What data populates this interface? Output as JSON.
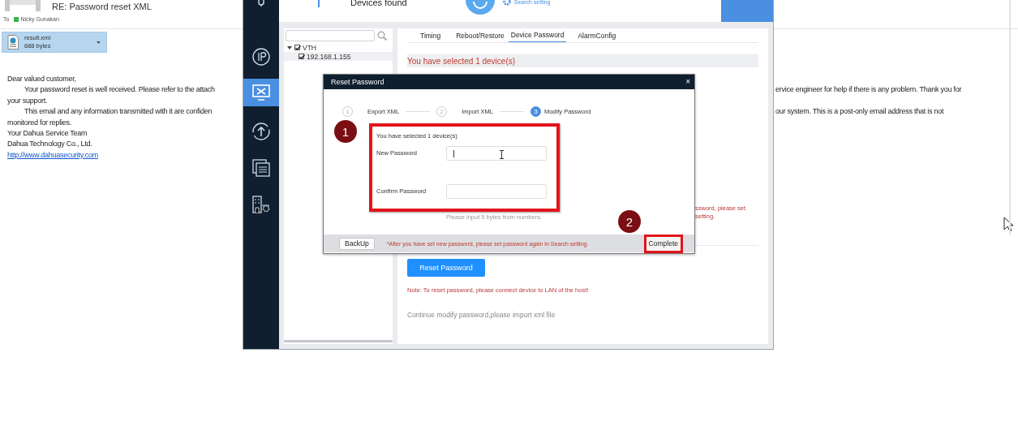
{
  "email": {
    "subject": "RE: Password reset XML",
    "to_label": "To",
    "recipient": "Nicky Gunakan",
    "attachment": {
      "name": "result.xml",
      "size": "688 bytes"
    },
    "lines": [
      {
        "text": "Dear valued customer,",
        "indent": false
      },
      {
        "text": "Your password reset is well received. Please refer to the attach",
        "indent": true,
        "right": "ervice engineer for help if there is any problem. Thank you for"
      },
      {
        "text": "your support.",
        "indent": false
      },
      {
        "text": "This email and any information transmitted with it are confiden",
        "indent": true,
        "right": "our system. This is a post-only email address that is not"
      },
      {
        "text": "monitored for replies.",
        "indent": false
      },
      {
        "text": "Your Dahua Service Team",
        "indent": false
      },
      {
        "text": "Dahua Technology Co., Ltd.",
        "indent": false
      }
    ],
    "link": "http://www.dahuasecurity.com"
  },
  "app": {
    "header": {
      "title": "Devices found",
      "search_setting": "Search setting"
    },
    "sidebar": [
      {
        "kind": "ip",
        "selected": false
      },
      {
        "kind": "tools",
        "selected": true
      },
      {
        "kind": "upgrade",
        "selected": false
      },
      {
        "kind": "windows",
        "selected": false
      },
      {
        "kind": "building",
        "selected": false
      }
    ],
    "tree": [
      {
        "label": "VTH",
        "checked": true,
        "expanded": true,
        "selected": false,
        "children": [
          {
            "label": "192.168.1.155",
            "checked": true,
            "selected": true
          }
        ]
      }
    ],
    "tabs": [
      {
        "label": "Timing",
        "selected": false
      },
      {
        "label": "Reboot/Restore",
        "selected": false
      },
      {
        "label": "Device Password",
        "selected": true
      },
      {
        "label": "AlarmConfig",
        "selected": false
      }
    ],
    "selection_text": "You have selected 1 device(s)",
    "covered_lines": [
      "ssword, please set",
      "setting."
    ],
    "reset_button": "Reset Password",
    "note": "Note: To reset password, please connect device to LAN of the host!",
    "continue_text": "Continue modify password,please import xml file"
  },
  "dialog": {
    "title": "Reset Password",
    "close": "×",
    "steps": [
      {
        "number": "1",
        "label": "Export XML",
        "selected": false
      },
      {
        "number": "2",
        "label": "Import XML",
        "selected": false
      },
      {
        "number": "3",
        "label": "Modify Password",
        "selected": true
      }
    ],
    "selected_text": "You have selected 1 device(s)",
    "fields": [
      {
        "label": "New Password"
      },
      {
        "label": "Confirm Password"
      }
    ],
    "hint": "Please input 5 bytes from numbers.",
    "backup": "BackUp",
    "footer_note": "*After you have set new password, please set password again in Search setting.",
    "complete": "Complete"
  },
  "annotations": [
    {
      "number": "1"
    },
    {
      "number": "2"
    }
  ]
}
